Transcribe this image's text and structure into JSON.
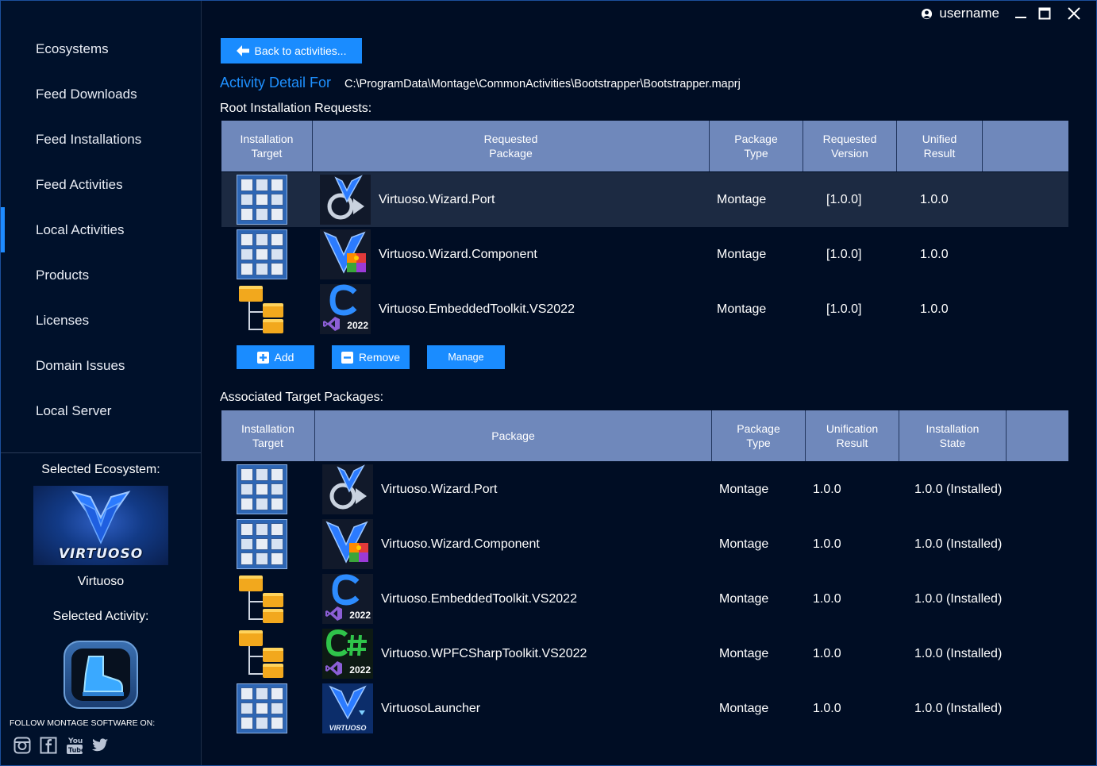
{
  "user": {
    "name": "username"
  },
  "sidebar": {
    "items": [
      {
        "label": "Ecosystems"
      },
      {
        "label": "Feed Downloads"
      },
      {
        "label": "Feed Installations"
      },
      {
        "label": "Feed Activities"
      },
      {
        "label": "Local Activities"
      },
      {
        "label": "Products"
      },
      {
        "label": "Licenses"
      },
      {
        "label": "Domain Issues"
      },
      {
        "label": "Local Server"
      }
    ],
    "active_index": 4,
    "selected_ecosystem_label": "Selected Ecosystem:",
    "ecosystem_logo_text": "VIRTUOSO",
    "ecosystem_name": "Virtuoso",
    "selected_activity_label": "Selected Activity:",
    "follow_label": "FOLLOW MONTAGE SOFTWARE ON:",
    "social_icons": [
      "instagram-icon",
      "facebook-icon",
      "youtube-icon",
      "twitter-icon"
    ]
  },
  "main": {
    "back_button_label": "Back to activities...",
    "detail_label": "Activity Detail For",
    "detail_path": "C:\\ProgramData\\Montage\\CommonActivities\\Bootstrapper\\Bootstrapper.maprj",
    "root_section_title": "Root Installation Requests:",
    "root_columns": [
      "Installation\nTarget",
      "Requested\nPackage",
      "Package\nType",
      "Requested\nVersion",
      "Unified\nResult"
    ],
    "root_rows": [
      {
        "target_icon": "grid",
        "package_icon": "port",
        "package": "Virtuoso.Wizard.Port",
        "type": "Montage",
        "requested_version": "[1.0.0]",
        "result": "1.0.0"
      },
      {
        "target_icon": "grid",
        "package_icon": "component",
        "package": "Virtuoso.Wizard.Component",
        "type": "Montage",
        "requested_version": "[1.0.0]",
        "result": "1.0.0"
      },
      {
        "target_icon": "folders",
        "package_icon": "c2022",
        "package": "Virtuoso.EmbeddedToolkit.VS2022",
        "type": "Montage",
        "requested_version": "[1.0.0]",
        "result": "1.0.0"
      }
    ],
    "root_selected_index": 0,
    "buttons": {
      "add": "Add",
      "remove": "Remove",
      "manage": "Manage"
    },
    "assoc_section_title": "Associated Target Packages:",
    "assoc_columns": [
      "Installation\nTarget",
      "Package",
      "Package\nType",
      "Unification\nResult",
      "Installation\nState"
    ],
    "assoc_rows": [
      {
        "target_icon": "grid",
        "package_icon": "port",
        "package": "Virtuoso.Wizard.Port",
        "type": "Montage",
        "result": "1.0.0",
        "state": "1.0.0 (Installed)"
      },
      {
        "target_icon": "grid",
        "package_icon": "component",
        "package": "Virtuoso.Wizard.Component",
        "type": "Montage",
        "result": "1.0.0",
        "state": "1.0.0 (Installed)"
      },
      {
        "target_icon": "folders",
        "package_icon": "c2022",
        "package": "Virtuoso.EmbeddedToolkit.VS2022",
        "type": "Montage",
        "result": "1.0.0",
        "state": "1.0.0 (Installed)"
      },
      {
        "target_icon": "folders",
        "package_icon": "cs2022",
        "package": "Virtuoso.WPFCSharpToolkit.VS2022",
        "type": "Montage",
        "result": "1.0.0",
        "state": "1.0.0 (Installed)"
      },
      {
        "target_icon": "grid",
        "package_icon": "launcher",
        "package": "VirtuosoLauncher",
        "type": "Montage",
        "result": "1.0.0",
        "state": "1.0.0 (Installed)"
      }
    ],
    "icon_year_label": "2022",
    "launcher_logo_text": "VIRTUOSO"
  },
  "colors": {
    "accent": "#1a8cff",
    "header": "#6f88bb",
    "background": "#000d24",
    "selected_row": "#1c2a42"
  }
}
